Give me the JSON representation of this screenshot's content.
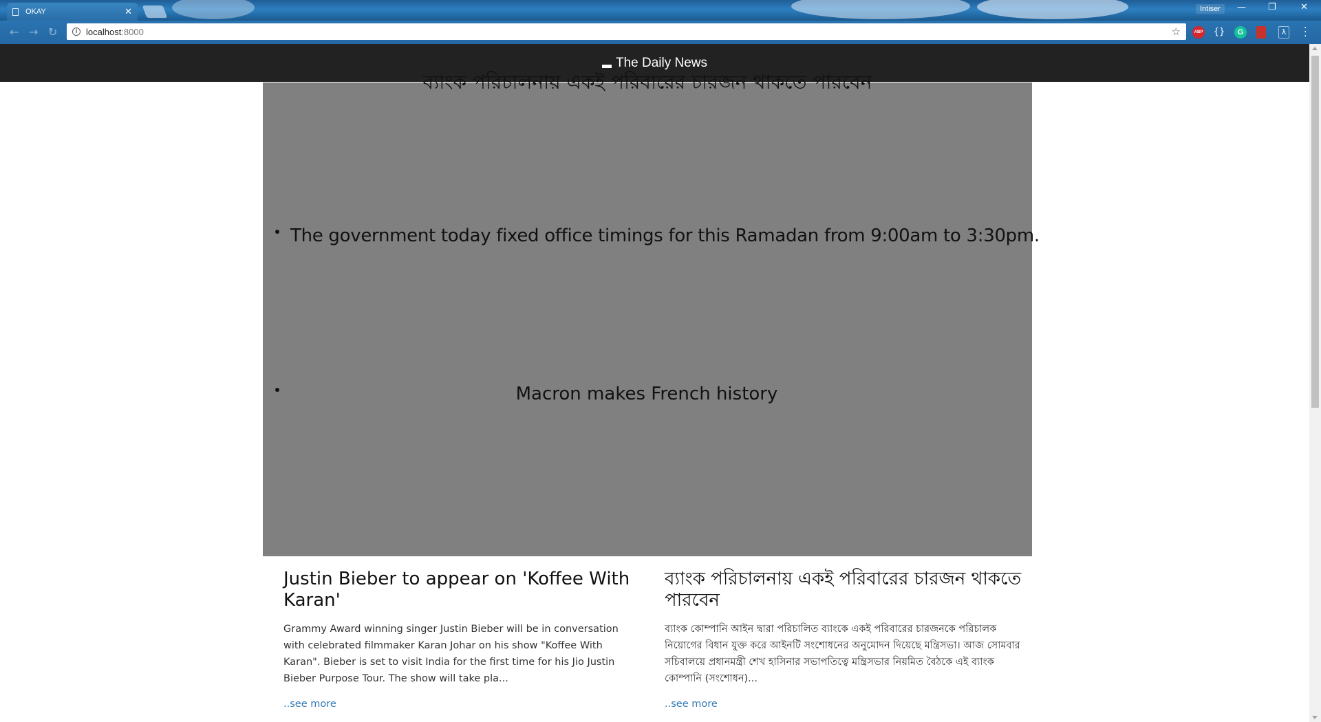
{
  "browser": {
    "tab_title": "OKAY",
    "tab_close": "✕",
    "profile_name": "Intiser",
    "url_host": "localhost",
    "url_port": ":8000",
    "window_controls": [
      "—",
      "❐",
      "✕"
    ],
    "bookmark_icon": "star-icon",
    "extensions": [
      "adblock-plus-icon",
      "json-braces-icon",
      "grammarly-icon",
      "bookmark-extension-icon",
      "lambda-extension-icon"
    ]
  },
  "site": {
    "brand": "The Daily News"
  },
  "carousel": {
    "heading": "ব্যাংক পরিচালনায় একই পরিবারের চারজন থাকতে পারবেন",
    "items": [
      "The government today fixed office timings for this Ramadan from 9:00am to 3:30pm.",
      "Macron makes French history"
    ],
    "background_color": "#808080"
  },
  "articles": [
    {
      "title": "Justin Bieber to appear on 'Koffee With Karan'",
      "summary": "Grammy Award winning singer Justin Bieber will be in conversation with celebrated filmmaker Karan Johar on his show \"Koffee With Karan\". Bieber is set to visit India for the first time for his Jio Justin Bieber Purpose Tour. The show will take pla...",
      "more_link": "..see more"
    },
    {
      "title": "ব্যাংক পরিচালনায় একই পরিবারের চারজন থাকতে পারবেন",
      "summary": "ব্যাংক কোম্পানি আইন দ্বারা পরিচালিত ব্যাংকে একই পরিবারের চারজনকে পরিচালক নিয়োগের বিধান যুক্ত করে আইনটি সংশোধনের অনুমোদন দিয়েছে মন্ত্রিসভা। আজ সোমবার সচিবালয়ে প্রধানমন্ত্রী শেখ হাসিনার সভাপতিত্বে মন্ত্রিসভার নিয়মিত বৈঠকে এই ব্যাংক কোম্পানি (সংশোধন)...",
      "more_link": "..see more"
    }
  ],
  "colors": {
    "navbar": "#222222",
    "link": "#337ab7",
    "browser_frame": "#2568a3"
  }
}
